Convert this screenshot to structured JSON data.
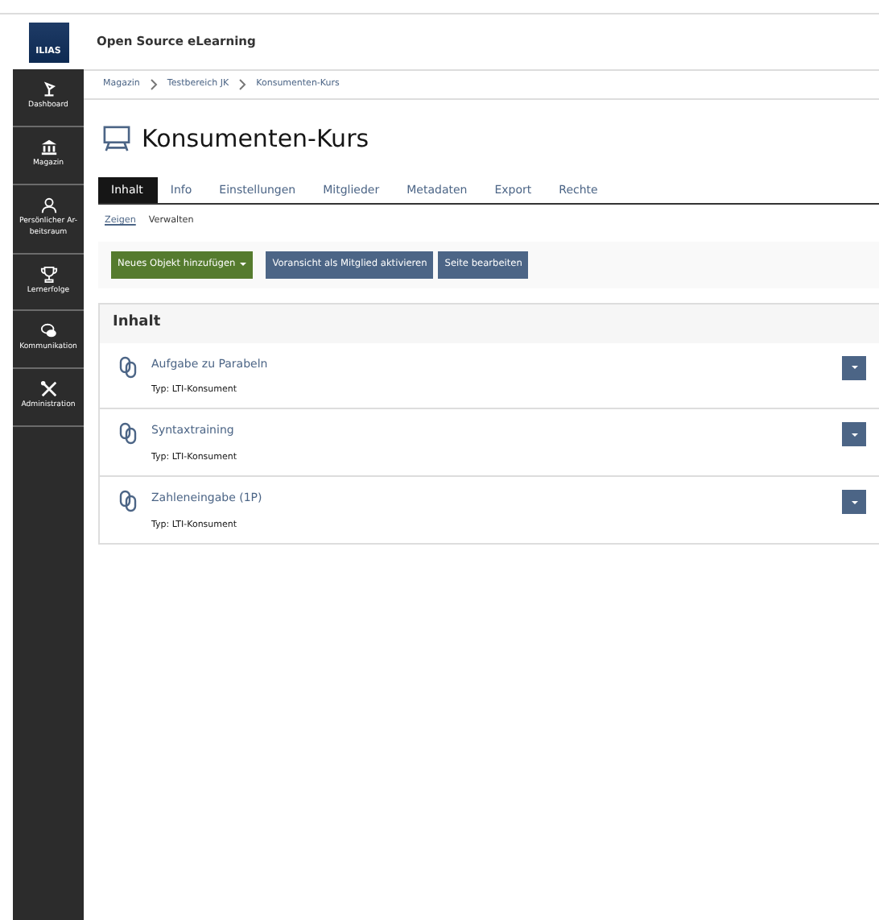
{
  "logo": "ILIAS",
  "header": {
    "title": "Open Source eLearning"
  },
  "sidebar": {
    "items": [
      {
        "label": "Dashboard"
      },
      {
        "label": "Magazin"
      },
      {
        "label": "Persönlicher Ar-beitsraum"
      },
      {
        "label": "Lernerfolge"
      },
      {
        "label": "Kommunikation"
      },
      {
        "label": "Administration"
      }
    ]
  },
  "breadcrumbs": [
    "Magazin",
    "Testbereich JK",
    "Konsumenten-Kurs"
  ],
  "page_title": "Konsumenten-Kurs",
  "tabs": [
    {
      "label": "Inhalt",
      "selected": true
    },
    {
      "label": "Info",
      "selected": false
    },
    {
      "label": "Einstellungen",
      "selected": false
    },
    {
      "label": "Mitglieder",
      "selected": false
    },
    {
      "label": "Metadaten",
      "selected": false
    },
    {
      "label": "Export",
      "selected": false
    },
    {
      "label": "Rechte",
      "selected": false
    }
  ],
  "subtabs": [
    {
      "label": "Zeigen",
      "selected": true
    },
    {
      "label": "Verwalten",
      "selected": false
    }
  ],
  "toolbar": [
    {
      "label": "Neues Objekt hinzufügen",
      "kind": "primary"
    },
    {
      "label": "Voransicht als Mitglied aktivieren",
      "kind": "secondary"
    },
    {
      "label": "Seite bearbeiten",
      "kind": "secondary"
    }
  ],
  "panel": {
    "title": "Inhalt",
    "items": [
      {
        "title": "Aufgabe zu Parabeln",
        "type": "Typ: LTI-Konsument"
      },
      {
        "title": "Syntaxtraining",
        "type": "Typ: LTI-Konsument"
      },
      {
        "title": "Zahleneingabe (1P)",
        "type": "Typ: LTI-Konsument"
      }
    ]
  }
}
